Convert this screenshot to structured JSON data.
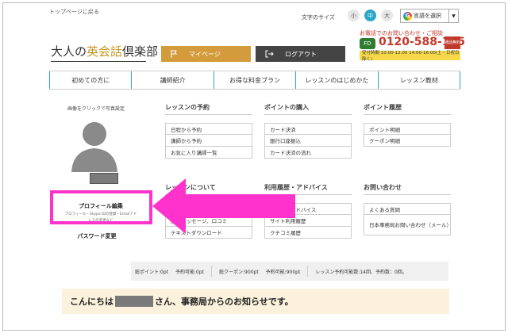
{
  "header": {
    "back_link": "トップページに戻る",
    "font_size_label": "文字のサイズ",
    "font_sizes": [
      "小",
      "中",
      "大"
    ],
    "translate_label": "言語を選択",
    "logo_pre": "大人の",
    "logo_hl": "英会話",
    "logo_post": "倶楽部",
    "mypage": "マイページ",
    "logout": "ログアウト"
  },
  "contact": {
    "top": "お電話でのお問い合わせ・ご相談",
    "phone": "0120-588-125",
    "freedial": "FD",
    "badge": "通話無料",
    "hours": "受付時間 10:00-12:00 14:00-16:00(土・日祝日除く)"
  },
  "nav": [
    "初めての方に",
    "講師紹介",
    "お得な料金プラン",
    "レッスンのはじめかた",
    "レッスン教材"
  ],
  "profile": {
    "photo_hint": "画像をクリックで写真設定",
    "edit": "プロフィール編集",
    "edit_sub1": "プロフィール・Skype IDの登録・Emailアド",
    "edit_sub2": "レスの変更など",
    "password": "パスワード変更"
  },
  "sections": [
    {
      "title": "レッスンの予約",
      "items": [
        "日程から予約",
        "講師から予約",
        "お気に入り講師一覧"
      ]
    },
    {
      "title": "ポイントの購入",
      "items": [
        "カード決済",
        "銀行口座振込",
        "カード決済の流れ"
      ]
    },
    {
      "title": "ポイント履歴",
      "items": [
        "ポイント明細",
        "クーポン明細"
      ]
    },
    {
      "title": "レッスンについて",
      "items": [
        "",
        "講師メッセージ、口コミ",
        "テキストダウンロード"
      ]
    },
    {
      "title": "利用履歴・アドバイス",
      "items": [
        "レッスンアドバイス",
        "サイト利用履歴",
        "クチコミ履歴"
      ]
    },
    {
      "title": "お問い合わせ",
      "items": [
        "よくある質問",
        "日本事務局お問い合わせ（メール）"
      ]
    }
  ],
  "stats": {
    "total_points": "総ポイント:0pt",
    "bookable": "予約可能:0pt",
    "total_coupons": "総クーポン:900pt",
    "bookable2": "予約可能:900pt",
    "lesson": "レッスン予約可能数:14回、予約数：0回。"
  },
  "notice": {
    "pre": "こんにちは",
    "post": "さん、事務局からのお知らせです。"
  },
  "colors": {
    "accent": "#2ba6c9",
    "mypage": "#d49b3c",
    "highlight": "#ff33cc",
    "notice_bg": "#fbf1dc"
  }
}
